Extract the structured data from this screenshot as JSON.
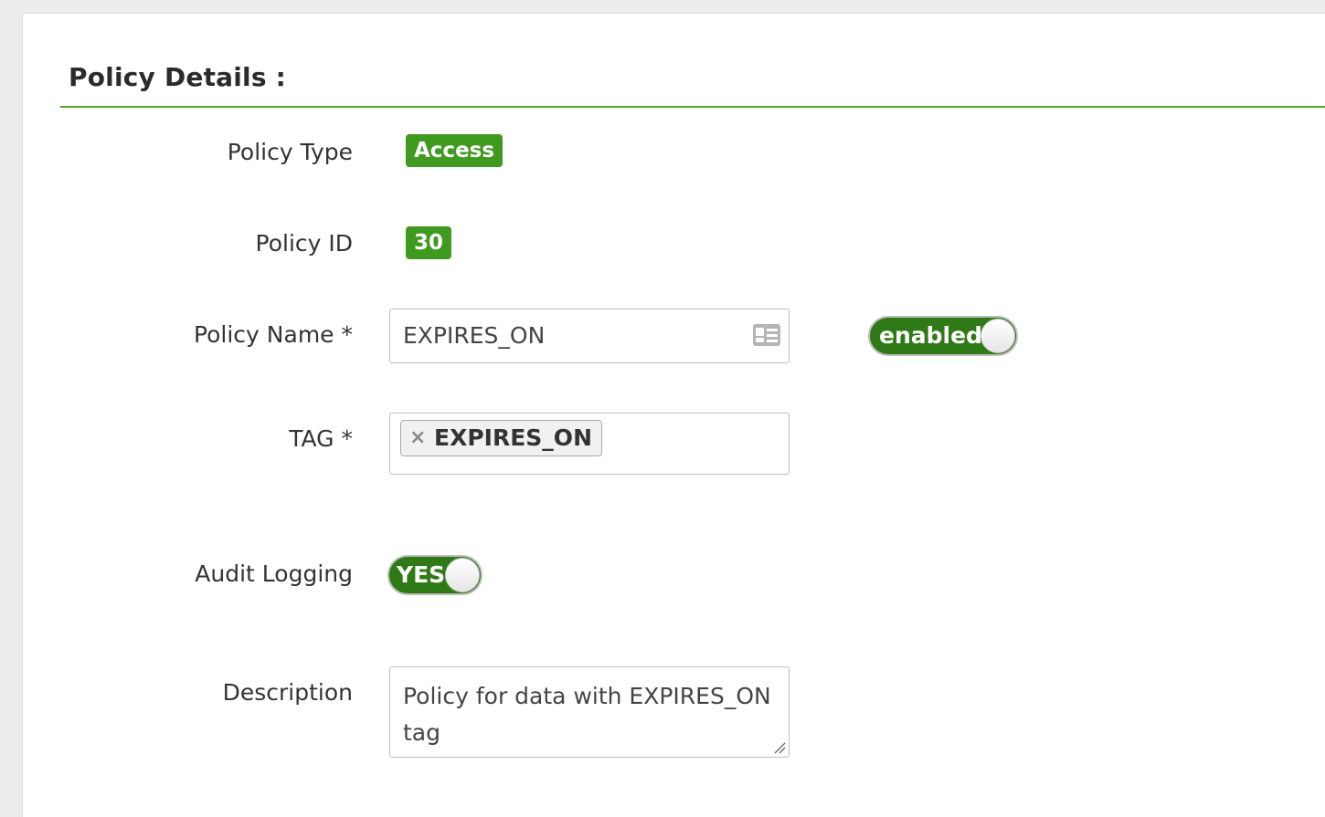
{
  "section": {
    "title": "Policy Details :"
  },
  "policy_type": {
    "label": "Policy Type",
    "value": "Access"
  },
  "policy_id": {
    "label": "Policy ID",
    "value": "30"
  },
  "policy_name": {
    "label": "Policy Name *",
    "value": "EXPIRES_ON",
    "status_toggle_label": "enabled"
  },
  "tag": {
    "label": "TAG *",
    "chips": [
      "EXPIRES_ON"
    ],
    "remove_symbol": "×"
  },
  "audit_logging": {
    "label": "Audit Logging",
    "toggle_label": "YES"
  },
  "description": {
    "label": "Description",
    "value": "Policy for data with EXPIRES_ON tag"
  },
  "colors": {
    "accent_green": "#3f9a1f",
    "toggle_green": "#2f7a16",
    "rule_green": "#5a9f2f"
  },
  "icons": {
    "policy_name_field": "id-card-icon",
    "tag_chip_remove": "close-icon"
  }
}
